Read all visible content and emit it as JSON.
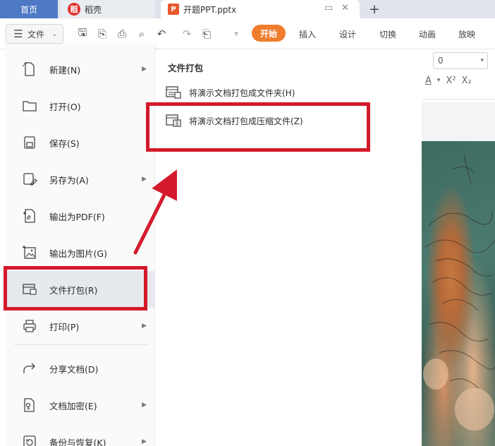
{
  "tabs": {
    "home": "首页",
    "docer": "稻壳",
    "document": "开题PPT.pptx",
    "add": "+"
  },
  "toolbar": {
    "file_label": "文件",
    "ribbon_tabs": [
      "开始",
      "插入",
      "设计",
      "切换",
      "动画",
      "放映"
    ]
  },
  "ribbon_right": {
    "font_size_value": "0",
    "format_buttons": [
      "A",
      "X²",
      "X₂"
    ]
  },
  "file_menu": {
    "items": [
      {
        "label": "新建(N)",
        "icon": "new-file-icon",
        "has_submenu": true
      },
      {
        "label": "打开(O)",
        "icon": "folder-icon",
        "has_submenu": false
      },
      {
        "label": "保存(S)",
        "icon": "save-icon",
        "has_submenu": false
      },
      {
        "label": "另存为(A)",
        "icon": "save-as-icon",
        "has_submenu": true
      },
      {
        "label": "输出为PDF(F)",
        "icon": "export-pdf-icon",
        "has_submenu": false
      },
      {
        "label": "输出为图片(G)",
        "icon": "export-image-icon",
        "has_submenu": false
      },
      {
        "label": "文件打包(R)",
        "icon": "package-icon",
        "has_submenu": false,
        "active": true
      },
      {
        "label": "打印(P)",
        "icon": "printer-icon",
        "has_submenu": true
      },
      {
        "label": "分享文档(D)",
        "icon": "share-icon",
        "has_submenu": false
      },
      {
        "label": "文档加密(E)",
        "icon": "lock-doc-icon",
        "has_submenu": true
      },
      {
        "label": "备份与恢复(K)",
        "icon": "backup-icon",
        "has_submenu": true
      }
    ]
  },
  "submenu": {
    "title": "文件打包",
    "items": [
      {
        "label": "将演示文档打包成文件夹(H)",
        "icon": "package-folder-icon"
      },
      {
        "label": "将演示文档打包成压缩文件(Z)",
        "icon": "package-zip-icon"
      }
    ]
  },
  "colors": {
    "highlight_red": "#d31a2b",
    "start_tab_orange": "#ef7d2d",
    "home_tab_blue": "#4e79c4"
  }
}
